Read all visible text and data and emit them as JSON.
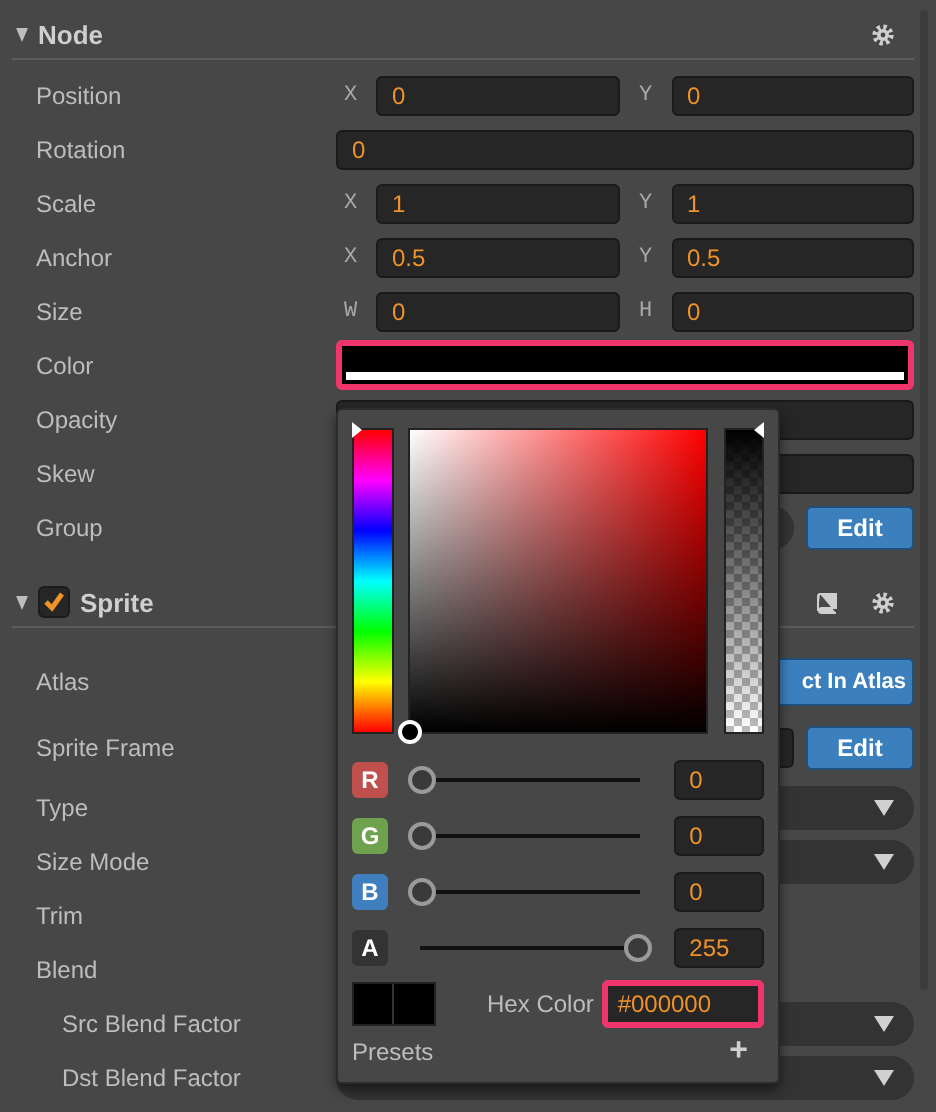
{
  "node": {
    "title": "Node",
    "expanded": true,
    "rows": [
      {
        "kind": "xy",
        "label": "Position",
        "fields": [
          {
            "axis": "X",
            "value": "0"
          },
          {
            "axis": "Y",
            "value": "0"
          }
        ]
      },
      {
        "kind": "single",
        "label": "Rotation",
        "value": "0"
      },
      {
        "kind": "xy",
        "label": "Scale",
        "fields": [
          {
            "axis": "X",
            "value": "1"
          },
          {
            "axis": "Y",
            "value": "1"
          }
        ]
      },
      {
        "kind": "xy",
        "label": "Anchor",
        "fields": [
          {
            "axis": "X",
            "value": "0.5"
          },
          {
            "axis": "Y",
            "value": "0.5"
          }
        ]
      },
      {
        "kind": "xy",
        "label": "Size",
        "fields": [
          {
            "axis": "W",
            "value": "0"
          },
          {
            "axis": "H",
            "value": "0"
          }
        ]
      },
      {
        "kind": "color",
        "label": "Color",
        "focused": true
      },
      {
        "kind": "field",
        "label": "Opacity"
      },
      {
        "kind": "field",
        "label": "Skew"
      },
      {
        "kind": "select-button",
        "label": "Group",
        "button": "Edit"
      }
    ]
  },
  "sprite": {
    "title": "Sprite",
    "expanded": true,
    "enabled": true,
    "rows": [
      {
        "kind": "button",
        "label": "Atlas",
        "button": "ct In Atlas"
      },
      {
        "kind": "asset-button",
        "label": "Sprite Frame",
        "button": "Edit"
      },
      {
        "kind": "select",
        "label": "Type"
      },
      {
        "kind": "select",
        "label": "Size Mode"
      },
      {
        "kind": "empty",
        "label": "Trim"
      },
      {
        "kind": "empty",
        "label": "Blend",
        "children": [
          {
            "kind": "select",
            "label": "Src Blend Factor"
          },
          {
            "kind": "select",
            "label": "Dst Blend Factor"
          }
        ]
      }
    ]
  },
  "color_picker": {
    "channels": [
      {
        "name": "R",
        "color": "#c0504d",
        "level": 0,
        "value": "0"
      },
      {
        "name": "G",
        "color": "#6ea24f",
        "level": 0,
        "value": "0"
      },
      {
        "name": "B",
        "color": "#3f7fbf",
        "level": 0,
        "value": "0"
      },
      {
        "name": "A",
        "color": "#333333",
        "level": 1,
        "value": "255"
      }
    ],
    "hue": {
      "level": 0
    },
    "alpha": {
      "level": 1
    },
    "hex_label": "Hex Color",
    "hex_value": "#000000",
    "hex_focused": true,
    "presets_label": "Presets",
    "add_button": "+"
  }
}
